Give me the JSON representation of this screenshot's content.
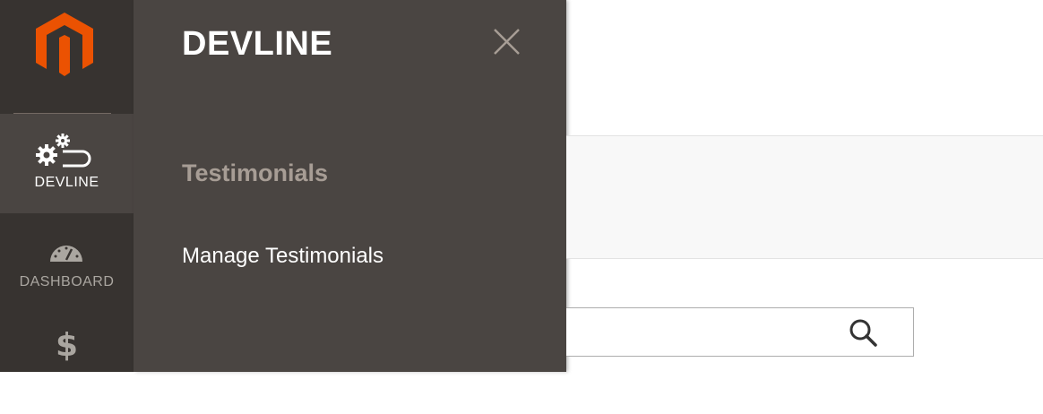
{
  "sidebar": {
    "logo_icon": "magento-logo-icon",
    "items": [
      {
        "label": "DEVLINE",
        "icon": "gears-icon",
        "active": true
      },
      {
        "label": "DASHBOARD",
        "icon": "speedometer-icon",
        "active": false
      },
      {
        "label": "",
        "icon": "dollar-icon",
        "glyph": "$",
        "active": false
      }
    ]
  },
  "panel": {
    "title": "DEVLINE",
    "close_icon": "close-icon",
    "section_title": "Testimonials",
    "links": [
      {
        "label": "Manage Testimonials"
      }
    ]
  },
  "search": {
    "value": "",
    "placeholder": "",
    "icon": "search-icon"
  },
  "colors": {
    "logo_orange": "#eb5202",
    "rail_bg": "#373330",
    "panel_bg": "#4a4542",
    "section_text": "#a79d95"
  }
}
